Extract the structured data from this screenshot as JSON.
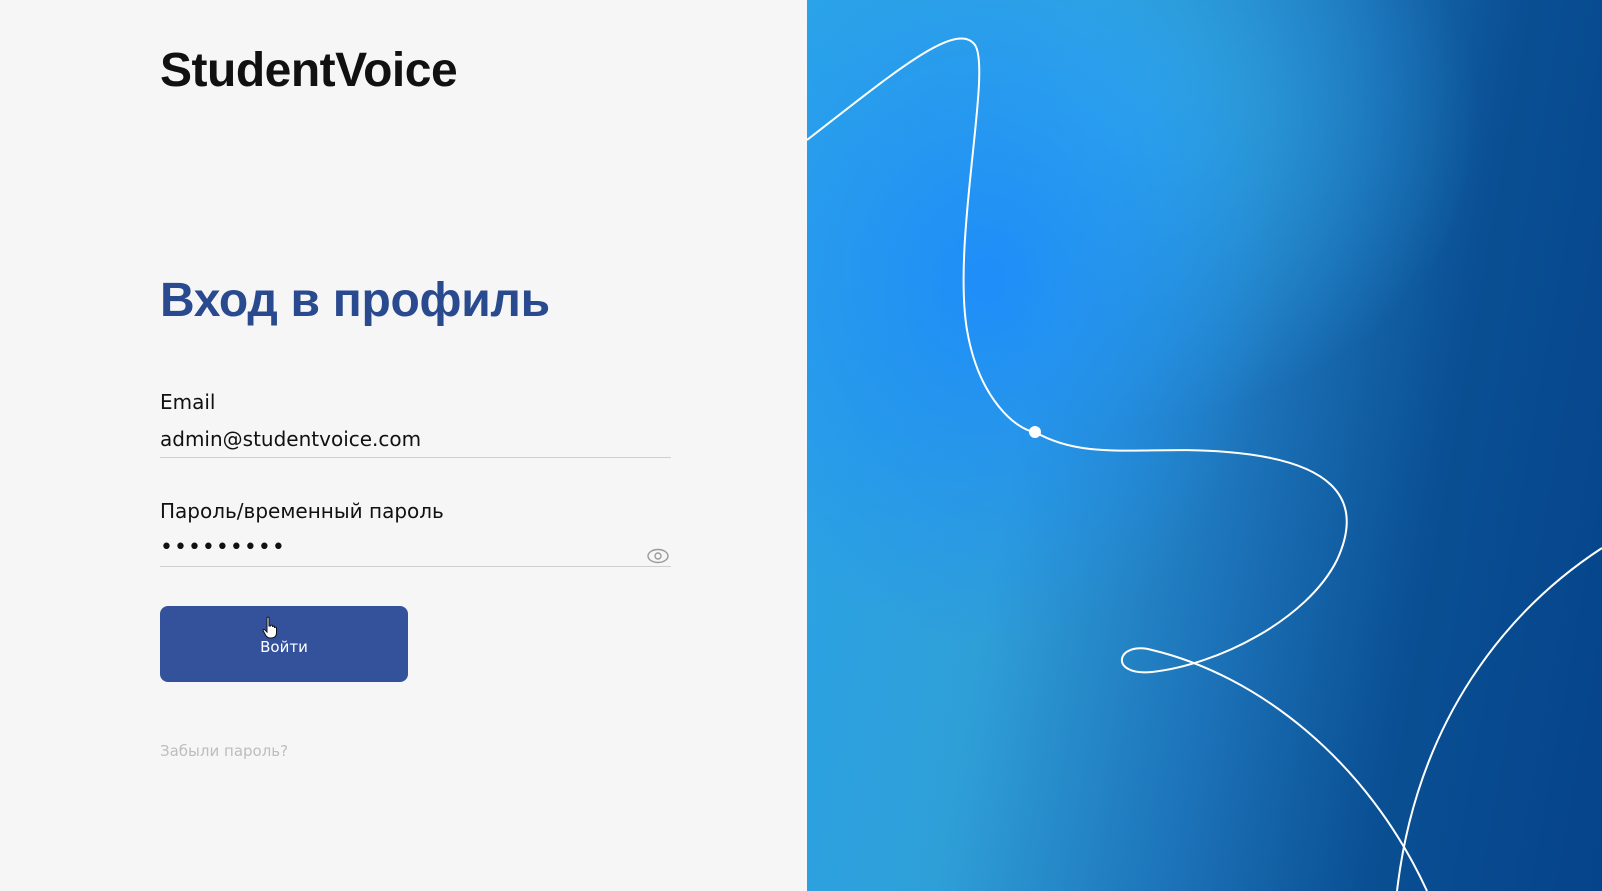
{
  "app": {
    "brand": "StudentVoice"
  },
  "form": {
    "title": "Вход в профиль",
    "email_label": "Email",
    "email_value": "admin@studentvoice.com",
    "password_label": "Пароль/временный пароль",
    "password_value": "•••••••••",
    "show_password_icon": "eye-icon",
    "submit_label": "Войти",
    "forgot_label": "Забыли пароль?"
  },
  "colors": {
    "background": "#f6f6f6",
    "heading": "#2a4a8f",
    "button": "#34519b",
    "hero_gradient_start": "#2aa3e8",
    "hero_gradient_end": "#05438a"
  }
}
